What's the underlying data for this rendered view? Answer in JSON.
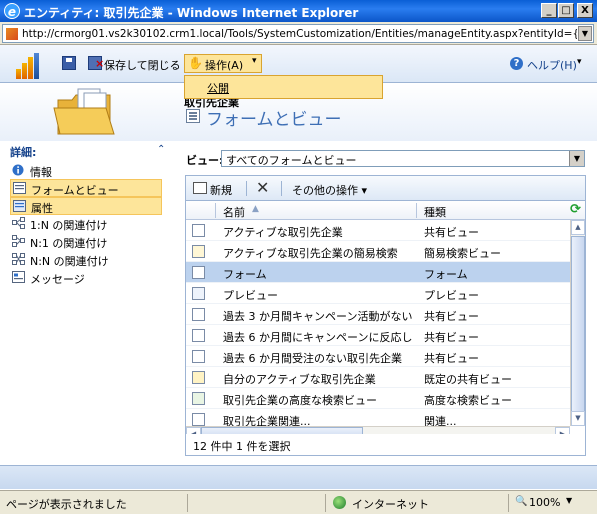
{
  "window": {
    "title": "エンティティ: 取引先企業 - Windows Internet Explorer",
    "buttons": {
      "minimize": "_",
      "maximize": "□",
      "close": "X"
    }
  },
  "address": {
    "url": "http://crmorg01.vs2k30102.crm1.local/Tools/SystemCustomization/Entities/manageEntity.aspx?entityId={7"
  },
  "toolbar": {
    "save_and_close": "保存して閉じる",
    "actions": "操作(A)",
    "actions_menu": [
      "公開"
    ],
    "help": "ヘルプ(H)"
  },
  "header": {
    "entity": "取引先企業",
    "title": "フォームとビュー"
  },
  "nav": {
    "header": "詳細:",
    "items": [
      {
        "label": "情報",
        "icon": "info-icon",
        "selected": false
      },
      {
        "label": "フォームとビュー",
        "icon": "form-icon",
        "selected": true
      },
      {
        "label": "属性",
        "icon": "attribute-icon",
        "selected": true
      },
      {
        "label": "1:N の関連付け",
        "icon": "relation-1n-icon",
        "selected": false
      },
      {
        "label": "N:1 の関連付け",
        "icon": "relation-n1-icon",
        "selected": false
      },
      {
        "label": "N:N の関連付け",
        "icon": "relation-nn-icon",
        "selected": false
      },
      {
        "label": "メッセージ",
        "icon": "message-icon",
        "selected": false
      }
    ]
  },
  "view": {
    "label": "ビュー:",
    "selected": "すべてのフォームとビュー"
  },
  "grid": {
    "toolbar": {
      "new": "新規",
      "more": "その他の操作"
    },
    "columns": [
      "名前",
      "種類"
    ],
    "rows": [
      {
        "name": "アクティブな取引先企業",
        "type": "共有ビュー",
        "icon": "view-icon",
        "selected": false
      },
      {
        "name": "アクティブな取引先企業の簡易検索",
        "type": "簡易検索ビュー",
        "icon": "quick-find-icon",
        "selected": false
      },
      {
        "name": "フォーム",
        "type": "フォーム",
        "icon": "form-icon",
        "selected": true
      },
      {
        "name": "プレビュー",
        "type": "プレビュー",
        "icon": "preview-icon",
        "selected": false
      },
      {
        "name": "過去 3 か月間キャンペーン活動がない...",
        "type": "共有ビュー",
        "icon": "view-icon",
        "selected": false
      },
      {
        "name": "過去 6 か月間にキャンペーンに反応し...",
        "type": "共有ビュー",
        "icon": "view-icon",
        "selected": false
      },
      {
        "name": "過去 6 か月間受注のない取引先企業",
        "type": "共有ビュー",
        "icon": "view-icon",
        "selected": false
      },
      {
        "name": "自分のアクティブな取引先企業",
        "type": "既定の共有ビュー",
        "icon": "default-view-icon",
        "selected": false
      },
      {
        "name": "取引先企業の高度な検索ビュー",
        "type": "高度な検索ビュー",
        "icon": "advanced-find-icon",
        "selected": false
      },
      {
        "name": "取引先企業関連...",
        "type": "関連...",
        "icon": "view-icon",
        "selected": false
      }
    ],
    "status": "12 件中 1 件を選択"
  },
  "statusbar": {
    "text": "ページが表示されました",
    "zone": "インターネット",
    "zoom": "100%"
  }
}
